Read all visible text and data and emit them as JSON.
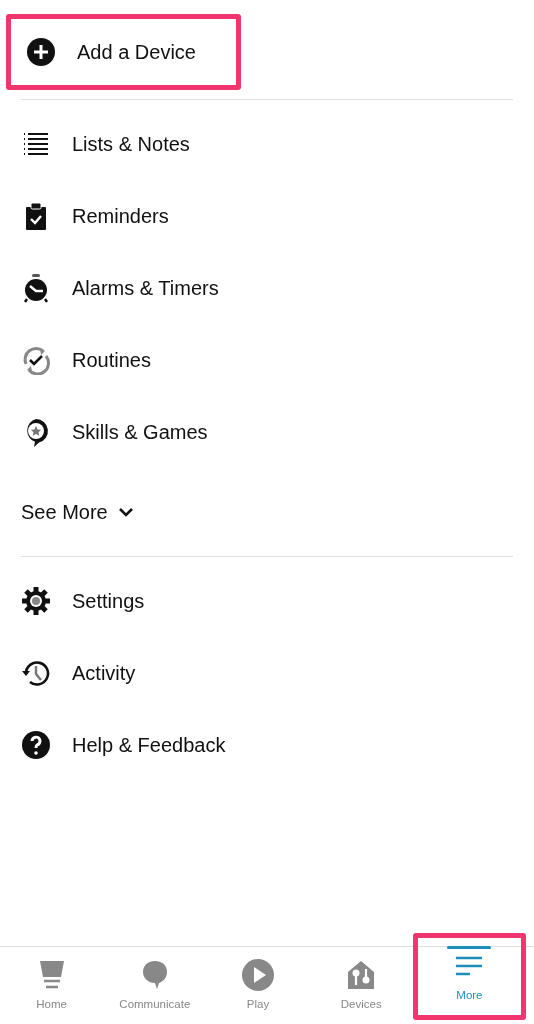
{
  "top_action": {
    "label": "Add a Device",
    "highlighted": true
  },
  "menu": [
    {
      "label": "Lists & Notes"
    },
    {
      "label": "Reminders"
    },
    {
      "label": "Alarms & Timers"
    },
    {
      "label": "Routines"
    },
    {
      "label": "Skills & Games"
    }
  ],
  "see_more": {
    "label": "See More",
    "expanded": false
  },
  "menu_2": [
    {
      "label": "Settings"
    },
    {
      "label": "Activity"
    },
    {
      "label": "Help & Feedback"
    }
  ],
  "bottom_nav": [
    {
      "label": "Home",
      "selected": false,
      "highlighted": false
    },
    {
      "label": "Communicate",
      "selected": false,
      "highlighted": false
    },
    {
      "label": "Play",
      "selected": false,
      "highlighted": false
    },
    {
      "label": "Devices",
      "selected": false,
      "highlighted": false
    },
    {
      "label": "More",
      "selected": true,
      "highlighted": true
    }
  ]
}
